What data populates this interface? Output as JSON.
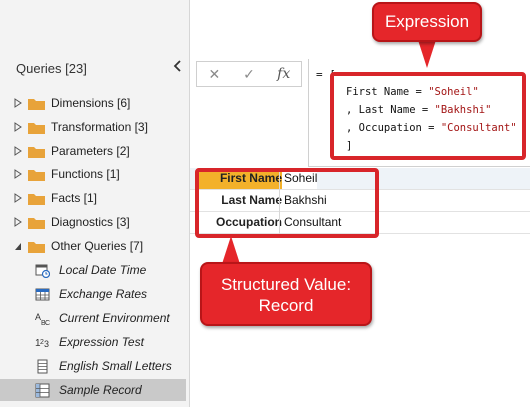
{
  "queries_pane": {
    "header": "Queries [23]",
    "groups": [
      {
        "label": "Dimensions [6]",
        "expanded": false
      },
      {
        "label": "Transformation [3]",
        "expanded": false
      },
      {
        "label": "Parameters [2]",
        "expanded": false
      },
      {
        "label": "Functions [1]",
        "expanded": false
      },
      {
        "label": "Facts [1]",
        "expanded": false
      },
      {
        "label": "Diagnostics [3]",
        "expanded": false
      },
      {
        "label": "Other Queries [7]",
        "expanded": true
      }
    ],
    "queries": [
      {
        "label": "Local Date Time",
        "icon": "datetime-icon"
      },
      {
        "label": "Exchange Rates",
        "icon": "table-icon"
      },
      {
        "label": "Current Environment",
        "icon": "text-type-icon"
      },
      {
        "label": "Expression Test",
        "icon": "number-type-icon"
      },
      {
        "label": "English Small Letters",
        "icon": "list-icon"
      },
      {
        "label": "Sample Record",
        "icon": "record-icon",
        "selected": true
      }
    ]
  },
  "formula_bar": {
    "cancel": "✕",
    "commit": "✓",
    "fx": "fx",
    "equals": "= [",
    "lines": [
      {
        "prefix": "First Name = ",
        "value": "\"Soheil\""
      },
      {
        "prefix": ", Last Name = ",
        "value": "\"Bakhshi\""
      },
      {
        "prefix": ", Occupation = ",
        "value": "\"Consultant\""
      },
      {
        "prefix": "]",
        "value": ""
      }
    ]
  },
  "record": {
    "rows": [
      {
        "key": "First Name",
        "value": "Soheil"
      },
      {
        "key": "Last Name",
        "value": "Bakhshi"
      },
      {
        "key": "Occupation",
        "value": "Consultant"
      }
    ]
  },
  "callouts": {
    "expression": "Expression",
    "structured_line1": "Structured Value:",
    "structured_line2": "Record"
  },
  "colors": {
    "callout_red": "#e5262a",
    "selected_key": "#f3b12a",
    "folder": "#e8a33a"
  }
}
